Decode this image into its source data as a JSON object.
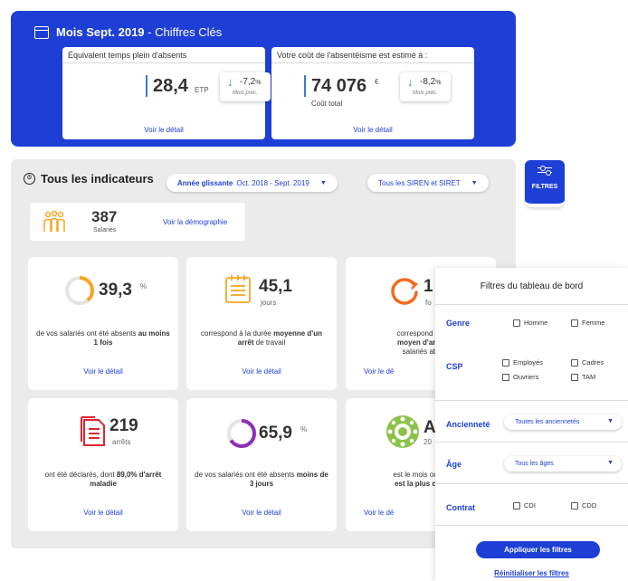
{
  "banner": {
    "title_bold": "Mois Sept. 2019",
    "title_rest": " - Chiffres Clés",
    "card1": {
      "label": "Équivalent temps plein d'absents",
      "value": "28,4",
      "unit": "ETP",
      "delta": "-7,2",
      "delta_unit": "%",
      "delta_label": "Mois préc.",
      "link": "Voir le détail"
    },
    "card2": {
      "label": "Votre coût de l'absentéisme est estimé à :",
      "value": "74 076",
      "unit": "€",
      "sub": "Coût total",
      "delta": "-8,2",
      "delta_unit": "%",
      "delta_label": "Mois préc.",
      "link": "Voir le détail"
    }
  },
  "indicators": {
    "title": "Tous les indicateurs",
    "period_bold": "Année glissante",
    "period_rest": "Oct. 2018 - Sept. 2019",
    "siren": "Tous les SIREN et SIRET",
    "salaries": {
      "value": "387",
      "label": "Salariés",
      "link": "Voir la démographie"
    },
    "cards": [
      {
        "value": "39,3",
        "unit": "%",
        "desc_pre": "de vos salariés ont été absents ",
        "desc_bold": "au moins 1 fois",
        "desc_post": "",
        "link": "Voir le détail",
        "fill": 0.393
      },
      {
        "value": "45,1",
        "unit": "jours",
        "desc_pre": "correspond à la durée ",
        "desc_bold": "moyenne d'un arrêt",
        "desc_post": " de travail",
        "link": "Voir le détail"
      },
      {
        "value": "1",
        "unit": "fo",
        "desc_pre": "correspond au",
        "desc_bold": "moyen d'arrê",
        "desc_post": "salariés ab",
        "link": "Voir le dé"
      },
      {
        "value": "219",
        "unit": "arrêts",
        "desc_pre": "ont été déclarés, dont ",
        "desc_bold": "89,0% d'arrêt maladie",
        "desc_post": "",
        "link": "Voir le détail"
      },
      {
        "value": "65,9",
        "unit": "%",
        "desc_pre": "de vos salariés ont été absents ",
        "desc_bold": "moins de 3 jours",
        "desc_post": "",
        "link": "Voir le détail",
        "fill": 0.659
      },
      {
        "value": "A",
        "unit": "20",
        "desc_pre": "est le mois où",
        "desc_bold": "est la plus c",
        "desc_post": "",
        "link": "Voir le dé"
      }
    ]
  },
  "filters_tab": {
    "label": "FILTRES"
  },
  "filters": {
    "title": "Filtres du tableau de bord",
    "genre": {
      "label": "Genre",
      "options": [
        "Homme",
        "Femme"
      ]
    },
    "csp": {
      "label": "CSP",
      "options": [
        "Employés",
        "Cadres",
        "Ouvriers",
        "TAM"
      ]
    },
    "anciennete": {
      "label": "Ancienneté",
      "value": "Toutes les anciennetés"
    },
    "age": {
      "label": "Âge",
      "value": "Tous les âges"
    },
    "contrat": {
      "label": "Contrat",
      "options": [
        "CDI",
        "CDD"
      ]
    },
    "apply": "Appliquer les filtres",
    "reset": "Réinitialiser les filtres"
  },
  "colors": {
    "brand": "#1d3fd6",
    "orange": "#f5a623",
    "red": "#e0262f",
    "purple": "#8e2fb5",
    "green": "#2aa84a"
  }
}
